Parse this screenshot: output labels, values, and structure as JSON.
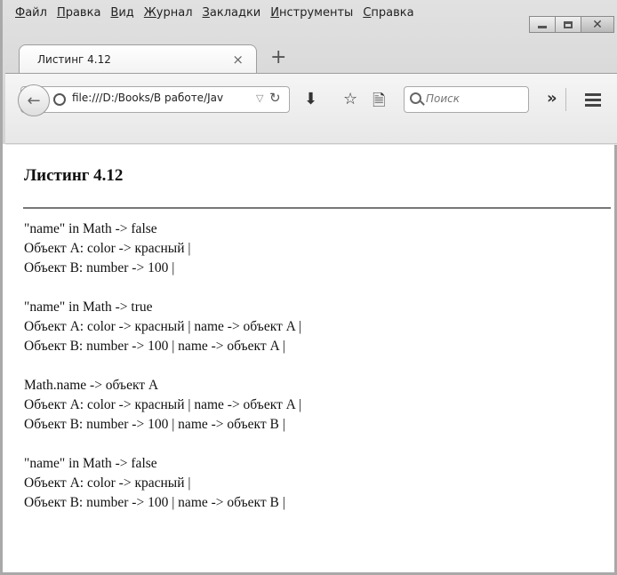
{
  "menu": [
    {
      "accel": "Ф",
      "rest": "айл"
    },
    {
      "accel": "П",
      "rest": "равка"
    },
    {
      "accel": "В",
      "rest": "ид"
    },
    {
      "accel": "Ж",
      "rest": "урнал"
    },
    {
      "accel": "З",
      "rest": "акладки"
    },
    {
      "accel": "И",
      "rest": "нструменты"
    },
    {
      "accel": "С",
      "rest": "правка"
    }
  ],
  "tab": {
    "title": "Листинг 4.12",
    "close": "×"
  },
  "newtab": "+",
  "urlbar": {
    "url": "file:///D:/Books/В работе/Jav"
  },
  "search": {
    "placeholder": "Поиск"
  },
  "page": {
    "title": "Листинг 4.12",
    "groups": [
      [
        "\"name\" in Math -> false",
        "Объект A: color -> красный |",
        "Объект B: number -> 100 |"
      ],
      [
        "\"name\" in Math -> true",
        "Объект A: color -> красный | name -> объект A |",
        "Объект B: number -> 100 | name -> объект A |"
      ],
      [
        "Math.name -> объект A",
        "Объект A: color -> красный | name -> объект A |",
        "Объект B: number -> 100 | name -> объект B |"
      ],
      [
        "\"name\" in Math -> false",
        "Объект A: color -> красный |",
        "Объект B: number -> 100 | name -> объект B |"
      ]
    ]
  }
}
